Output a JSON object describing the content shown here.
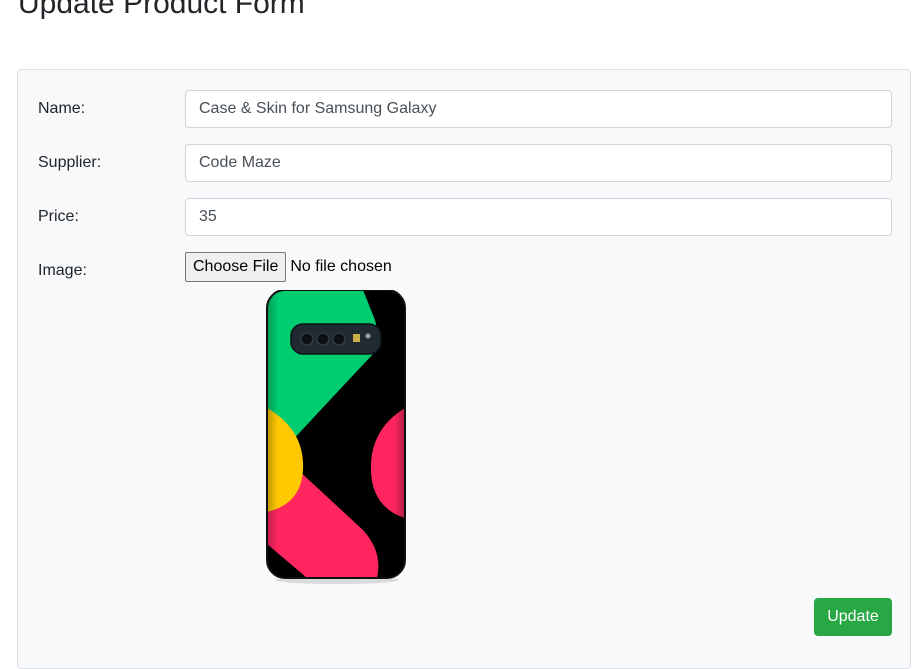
{
  "page": {
    "title": "Update Product Form"
  },
  "form": {
    "name": {
      "label": "Name:",
      "value": "Case & Skin for Samsung Galaxy"
    },
    "supplier": {
      "label": "Supplier:",
      "value": "Code Maze"
    },
    "price": {
      "label": "Price:",
      "value": "35"
    },
    "image": {
      "label": "Image:",
      "button_label": "Choose File",
      "status_text": "No file chosen",
      "preview_icon": "phone-case-image",
      "preview_colors": {
        "black": "#000000",
        "green": "#00cc70",
        "yellow": "#ffc800",
        "pink": "#ff2660"
      }
    },
    "update_label": "Update"
  },
  "colors": {
    "accent_success": "#28a745",
    "card_background": "#f8f9fa"
  }
}
